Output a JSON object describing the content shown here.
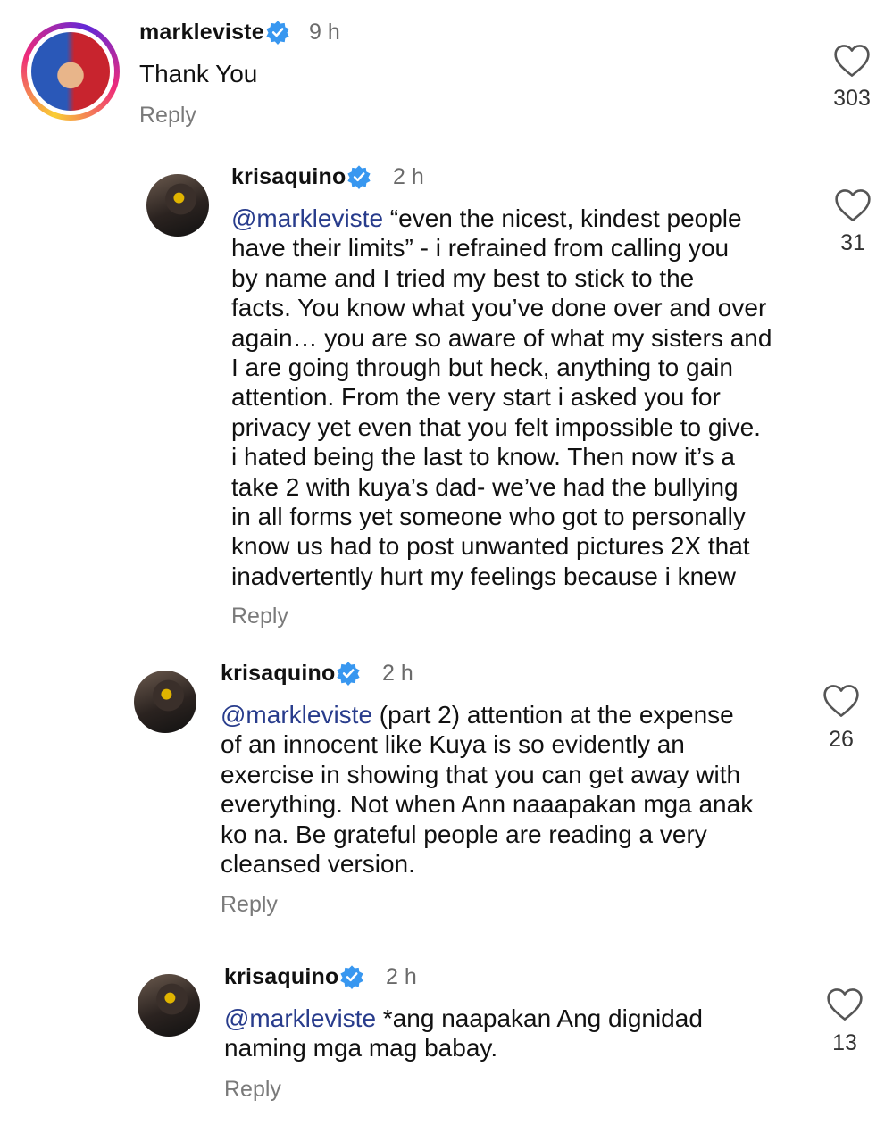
{
  "comments": [
    {
      "username": "markleviste",
      "time": "9 h",
      "text": "Thank You",
      "mention": "",
      "reply_label": "Reply",
      "likes": "303"
    },
    {
      "username": "krisaquino",
      "time": "2 h",
      "mention": "@markleviste",
      "lines": [
        " “even the nicest, kindest people",
        "have their limits” - i refrained from calling you",
        "by name and I tried my best to stick to the",
        "facts. You know what you’ve done over and over",
        "again… you are so aware of what my sisters and",
        "I are going through but heck, anything to gain",
        "attention. From the very start i asked you for",
        "privacy yet even that you felt impossible to give.",
        "i hated being the last to know. Then now it’s a",
        "take 2 with kuya’s dad- we’ve had the bullying",
        "in all forms yet someone who got to personally",
        "know us had to post unwanted pictures 2X that",
        "inadvertently hurt my feelings because i knew"
      ],
      "reply_label": "Reply",
      "likes": "31"
    },
    {
      "username": "krisaquino",
      "time": "2 h",
      "mention": "@markleviste",
      "lines": [
        " (part 2) attention at the expense",
        "of an innocent like Kuya is so evidently an",
        "exercise in showing that you can get away with",
        "everything. Not when Ann naaapakan mga anak",
        "ko na. Be grateful people are reading a very",
        "cleansed version."
      ],
      "reply_label": "Reply",
      "likes": "26"
    },
    {
      "username": "krisaquino",
      "time": "2 h",
      "mention": "@markleviste",
      "lines": [
        " *ang naapakan Ang dignidad",
        "naming mga mag babay."
      ],
      "reply_label": "Reply",
      "likes": "13"
    }
  ],
  "colors": {
    "verified": "#3897f0",
    "mention": "#283c8c",
    "meta": "#7a7a7a"
  },
  "icons": {
    "verified": "verified-badge-icon",
    "like": "heart-outline-icon"
  }
}
